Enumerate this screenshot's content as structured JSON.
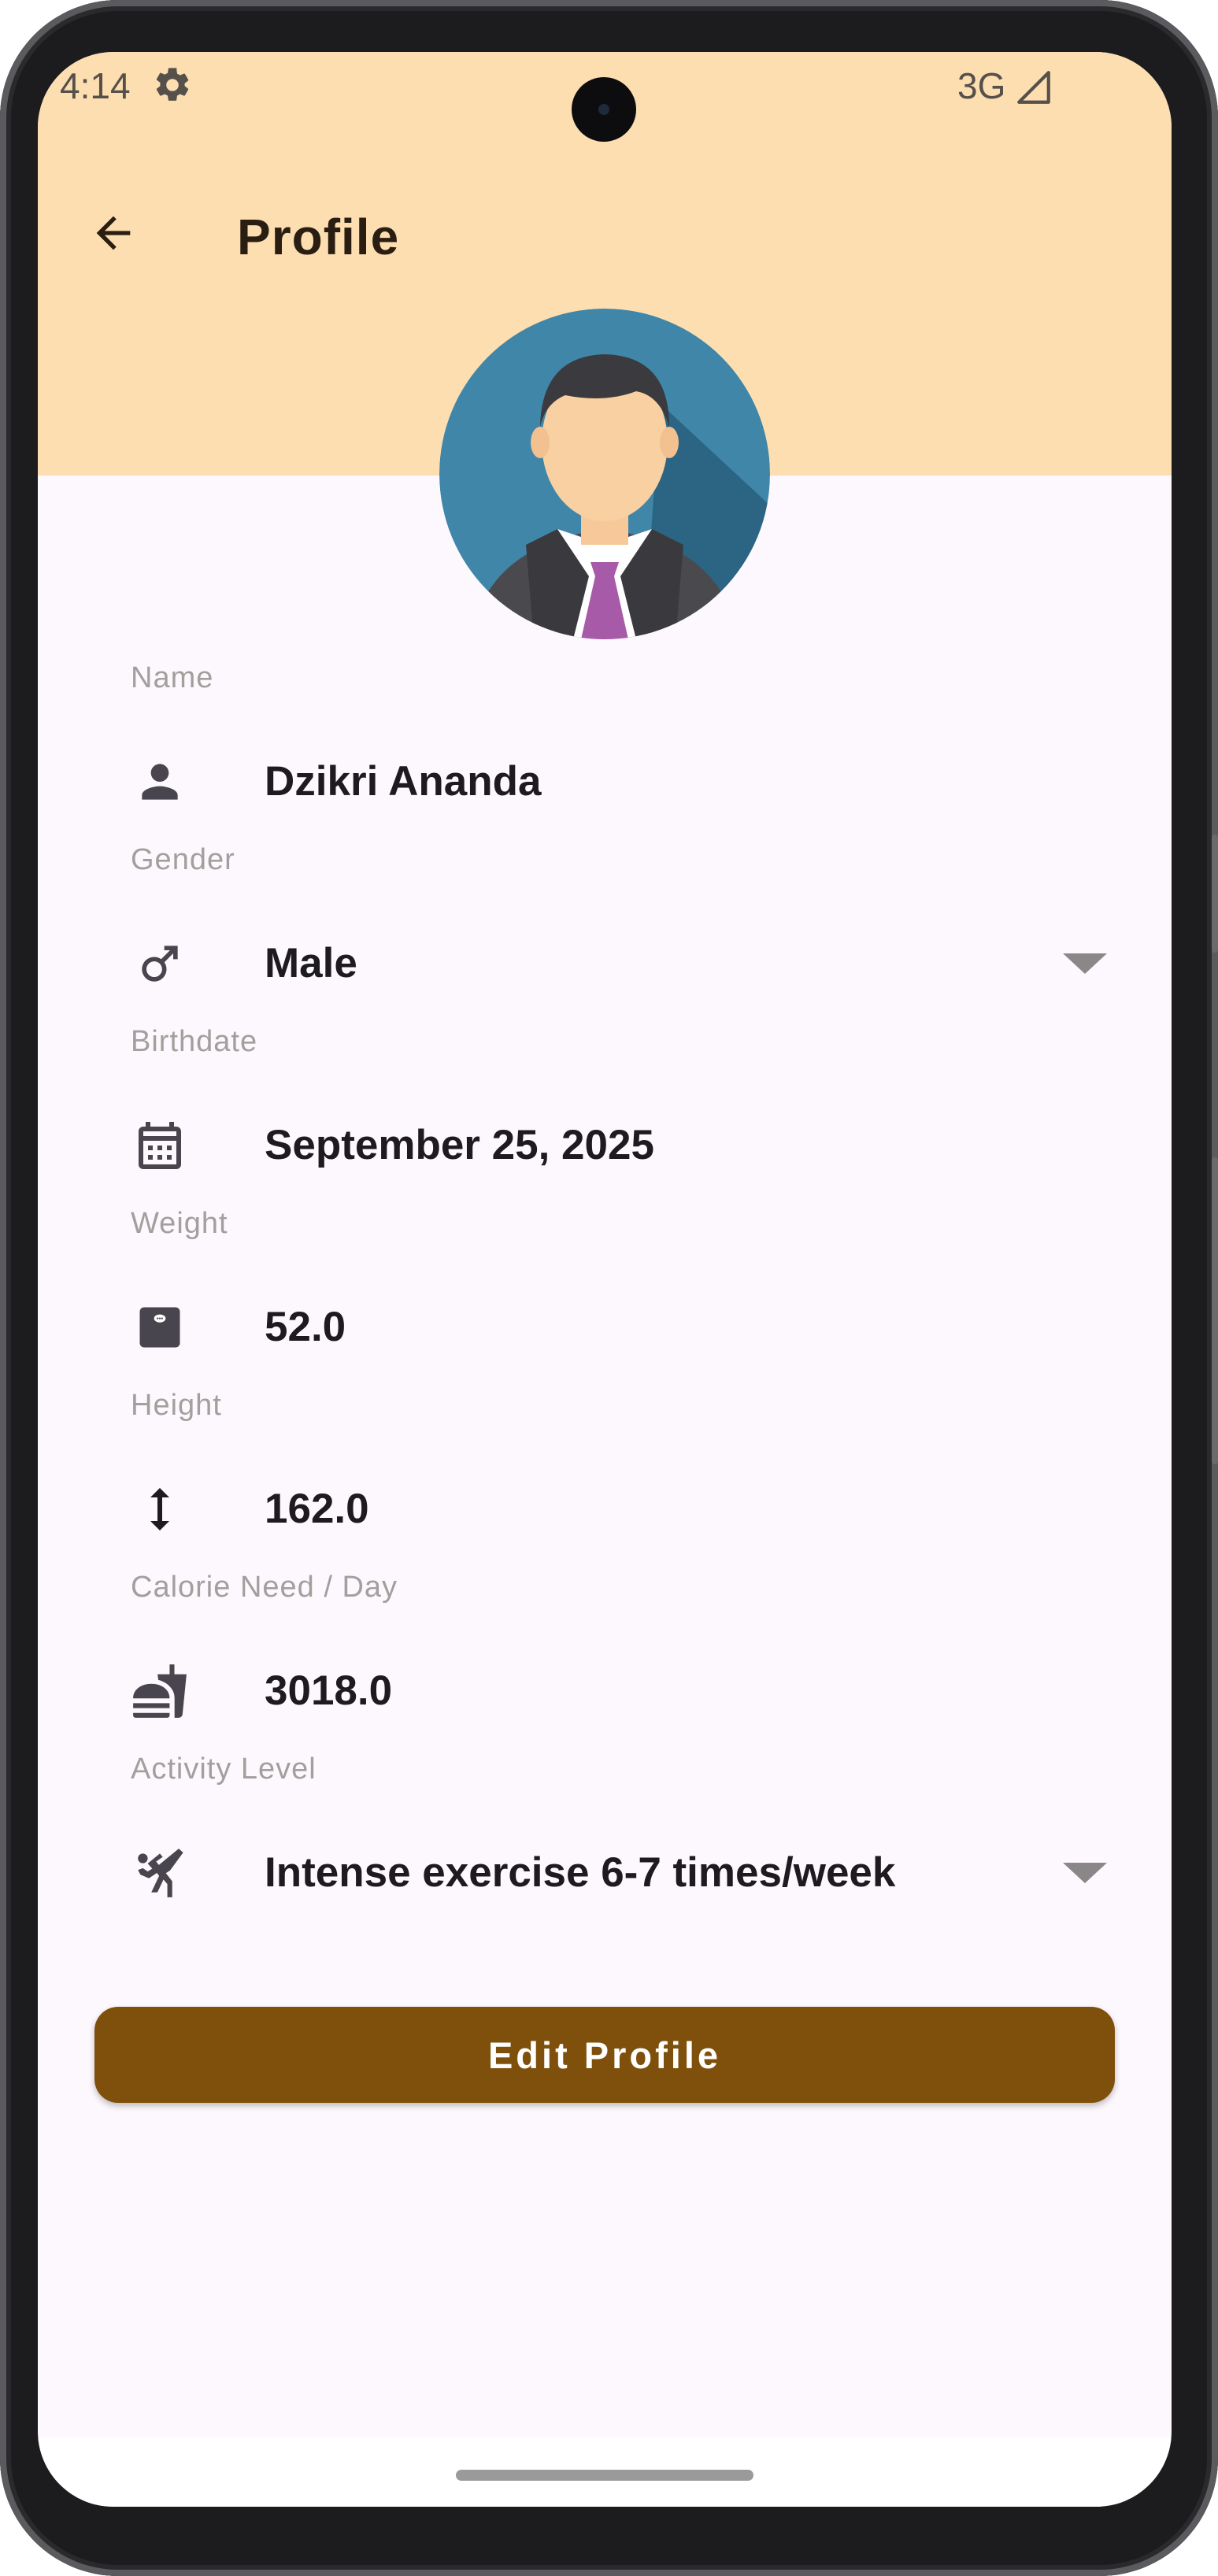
{
  "status_bar": {
    "time": "4:14",
    "network": "3G",
    "settings_icon": "gear-icon",
    "signal_icon": "signal-icon"
  },
  "app_bar": {
    "title": "Profile",
    "back_icon": "arrow-back-icon"
  },
  "colors": {
    "header_background": "#fddeb0",
    "page_background": "#fdf8fd",
    "primary_button": "#7e500c",
    "icon": "#48454e",
    "label": "#a39f9d"
  },
  "fields": [
    {
      "label": "Name",
      "value": "Dzikri Ananda",
      "icon": "person-icon"
    },
    {
      "label": "Gender",
      "value": "Male",
      "icon": "male-icon",
      "dropdown": true
    },
    {
      "label": "Birthdate",
      "value": "September 25, 2025",
      "icon": "calendar-icon"
    },
    {
      "label": "Weight",
      "value": "52.0",
      "icon": "scale-icon"
    },
    {
      "label": "Height",
      "value": "162.0",
      "icon": "height-icon"
    },
    {
      "label": "Calorie Need / Day",
      "value": "3018.0",
      "icon": "fastfood-icon"
    },
    {
      "label": "Activity Level",
      "value": "Intense exercise 6-7 times/week",
      "icon": "sports-martial-arts-icon",
      "dropdown": true
    }
  ],
  "actions": {
    "edit_profile": "Edit Profile"
  }
}
